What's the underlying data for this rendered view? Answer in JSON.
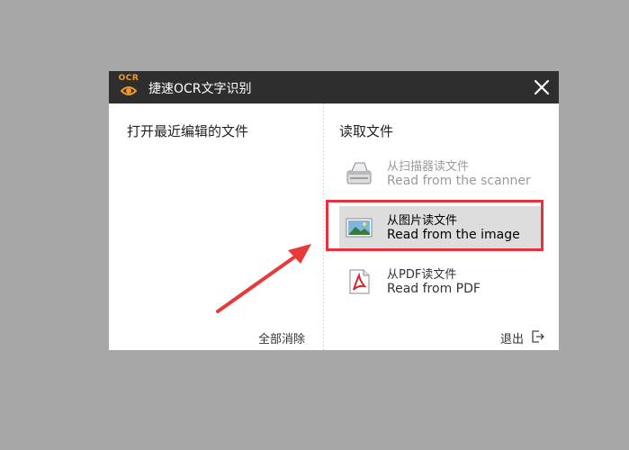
{
  "window": {
    "logo_text": "OCR",
    "title": "捷速OCR文字识别"
  },
  "left_panel": {
    "heading": "打开最近编辑的文件",
    "clear_all": "全部消除"
  },
  "right_panel": {
    "heading": "读取文件",
    "items": [
      {
        "cn": "从扫描器读文件",
        "en": "Read from the scanner",
        "icon": "scanner-icon",
        "state": "disabled"
      },
      {
        "cn": "从图片读文件",
        "en": "Read from the image",
        "icon": "image-icon",
        "state": "selected"
      },
      {
        "cn": "从PDF读文件",
        "en": "Read from PDF",
        "icon": "pdf-icon",
        "state": "enabled"
      }
    ],
    "exit_label": "退出"
  },
  "colors": {
    "titlebar": "#2e2e2e",
    "logo_orange": "#f39a21",
    "highlight_red": "#e5323d",
    "selected_bg": "#dddddd",
    "backdrop": "#a7a7a7"
  }
}
